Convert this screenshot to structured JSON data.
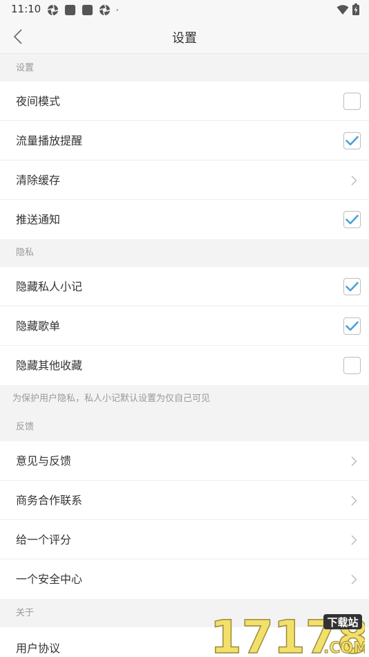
{
  "status_bar": {
    "time": "11:10"
  },
  "nav": {
    "title": "设置"
  },
  "sections": {
    "settings_header": "设置",
    "privacy_header": "隐私",
    "privacy_note": "为保护用户隐私，私人小记默认设置为仅自己可见",
    "feedback_header": "反馈",
    "about_header": "关于"
  },
  "settings": {
    "night_mode": {
      "label": "夜间模式",
      "checked": false
    },
    "data_reminder": {
      "label": "流量播放提醒",
      "checked": true
    },
    "clear_cache": {
      "label": "清除缓存"
    },
    "push": {
      "label": "推送通知",
      "checked": true
    }
  },
  "privacy": {
    "hide_notes": {
      "label": "隐藏私人小记",
      "checked": true
    },
    "hide_playlists": {
      "label": "隐藏歌单",
      "checked": true
    },
    "hide_other": {
      "label": "隐藏其他收藏",
      "checked": false
    }
  },
  "feedback": {
    "feedback": {
      "label": "意见与反馈"
    },
    "business": {
      "label": "商务合作联系"
    },
    "rate": {
      "label": "给一个评分"
    },
    "security": {
      "label": "一个安全中心"
    }
  },
  "about": {
    "agreement": {
      "label": "用户协议"
    }
  },
  "watermark": {
    "number": "17178",
    "badge": "下载站",
    "domain": ".COM"
  },
  "colors": {
    "check": "#4a9fd8",
    "row_bg": "#ffffff",
    "page_bg": "#f3f3f3",
    "watermark_yellow": "#f2e06a"
  },
  "icons": {
    "back": "chevron-left-icon",
    "arrow": "chevron-right-icon",
    "check": "checkmark-icon"
  }
}
